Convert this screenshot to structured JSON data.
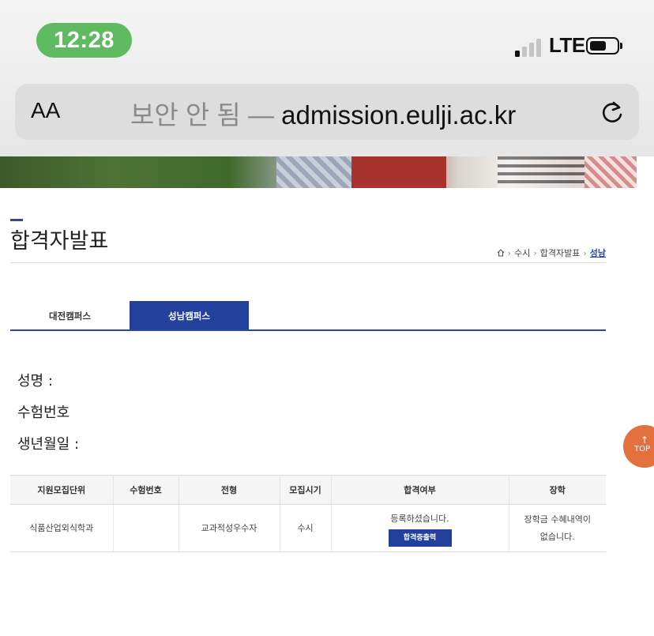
{
  "status_bar": {
    "time": "12:28",
    "carrier": "LTE"
  },
  "browser": {
    "text_size": "AA",
    "insecure_label": "보안 안 됨 —",
    "domain": "admission.eulji.ac.kr"
  },
  "page": {
    "title": "합격자발표",
    "breadcrumb": [
      "수시",
      "합격자발표",
      "성남"
    ]
  },
  "tabs": [
    "대전캠퍼스",
    "성남캠퍼스"
  ],
  "active_tab": "성남캠퍼스",
  "info": {
    "name_label": "성명 :",
    "exam_no_label": "수험번호",
    "birth_label": "생년월일 :"
  },
  "table": {
    "headers": [
      "지원모집단위",
      "수험번호",
      "전형",
      "모집시기",
      "합격여부",
      "장학"
    ],
    "row": {
      "unit": "식품산업외식학과",
      "exam_no": "",
      "type": "교과적성우수자",
      "period": "수시",
      "status": "등록하셨습니다.",
      "cert_button": "합격증출력",
      "scholarship_line1": "장학금 수혜내역이",
      "scholarship_line2": "없습니다."
    }
  },
  "top_button": {
    "label": "TOP",
    "arrow": "↑"
  },
  "colors": {
    "accent": "#23419c",
    "top_button": "#e3713d",
    "time_pill": "#5fba62"
  }
}
